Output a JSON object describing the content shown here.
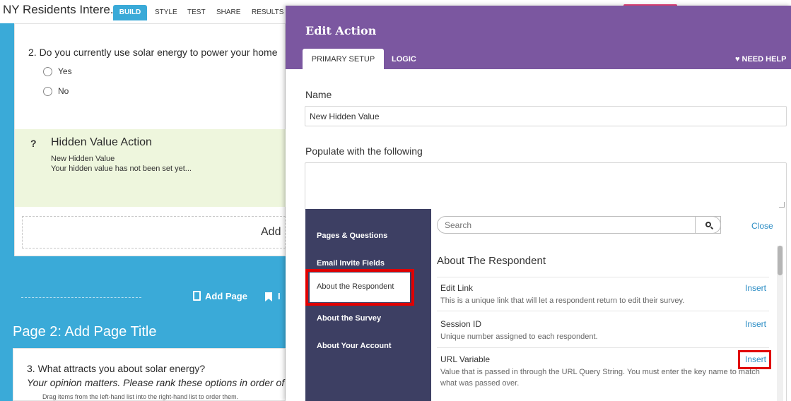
{
  "topbar": {
    "survey_title": "NY Residents Intere...",
    "tabs": [
      "BUILD",
      "STYLE",
      "TEST",
      "SHARE",
      "RESULTS"
    ]
  },
  "builder": {
    "q2_text": "2. Do you currently use solar energy to power your home",
    "q2_options": [
      "Yes",
      "No"
    ],
    "hidden_action": {
      "title": "Hidden Value Action",
      "value_name": "New Hidden Value",
      "status": "Your hidden value has not been set yet..."
    },
    "add_label": "Add",
    "add_page": "Add Page",
    "insert_partial": "I",
    "page2_title": "Page 2: Add Page Title",
    "q3_text": "3. What attracts you about solar energy?",
    "q3_subtitle": "Your opinion matters. Please rank these options in order of i",
    "q3_hint": "Drag items from the left-hand list into the right-hand list to order them."
  },
  "modal": {
    "title": "Edit Action",
    "tabs": {
      "primary": "PRIMARY SETUP",
      "logic": "LOGIC"
    },
    "need_help": "NEED HELP",
    "name_label": "Name",
    "name_value": "New Hidden Value",
    "populate_label": "Populate with the following",
    "insert_panel": {
      "categories": [
        "Pages & Questions",
        "Email Invite Fields",
        "About the Respondent",
        "About the Survey",
        "About Your Account"
      ],
      "search_placeholder": "Search",
      "close_label": "Close",
      "section_title": "About The Respondent",
      "items": [
        {
          "title": "Edit Link",
          "description": "This is a unique link that will let a respondent return to edit their survey.",
          "action": "Insert"
        },
        {
          "title": "Session ID",
          "description": "Unique number assigned to each respondent.",
          "action": "Insert"
        },
        {
          "title": "URL Variable",
          "description": "Value that is passed in through the URL Query String. You must enter the key name to match what was passed over.",
          "action": "Insert"
        }
      ]
    }
  },
  "colors": {
    "builder_blue": "#3aaad8",
    "modal_purple": "#7b57a0",
    "panel_navy": "#3d3f63",
    "highlight_red": "#e00000",
    "link_blue": "#2a8cc4"
  }
}
